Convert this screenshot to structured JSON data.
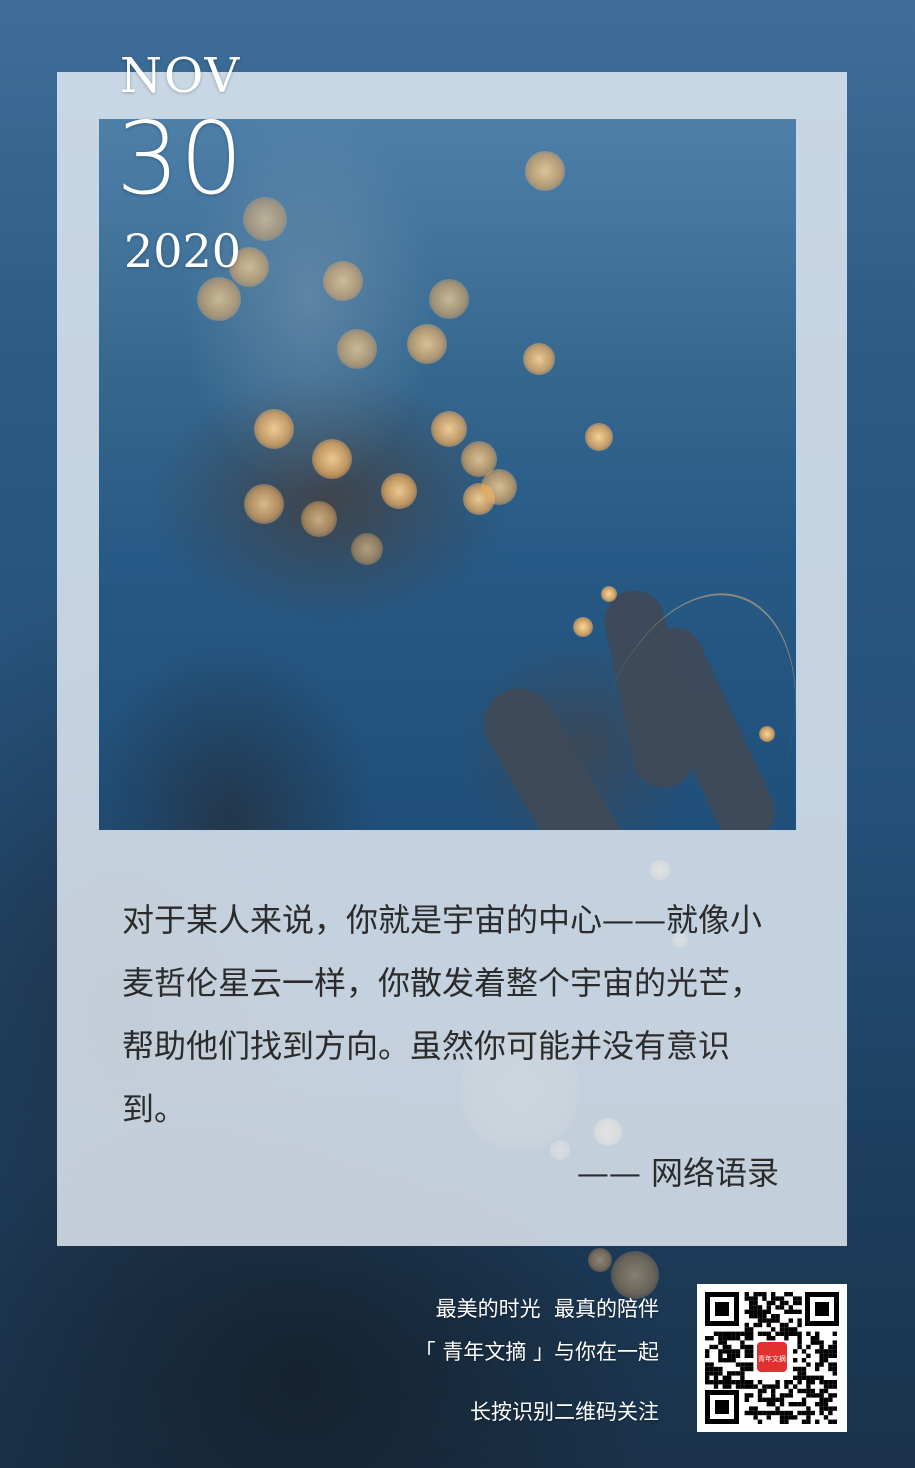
{
  "date": {
    "month": "NOV",
    "day": "30",
    "year": "2020"
  },
  "quote": {
    "text": "对于某人来说，你就是宇宙的中心——就像小麦哲伦星云一样，你散发着整个宇宙的光芒，帮助他们找到方向。虽然你可能并没有意识到。",
    "source": "—— 网络语录"
  },
  "footer": {
    "slogan": "最美的时光  最真的陪伴",
    "brand_line": "「 青年文摘 」与你在一起",
    "qr_hint": "长按识别二维码关注",
    "qr_logo_text": "青年文摘"
  },
  "colors": {
    "background": "#24507a",
    "frame": "#e4ecf4",
    "bokeh": "#f2b96a",
    "qr_logo": "#e03030"
  }
}
